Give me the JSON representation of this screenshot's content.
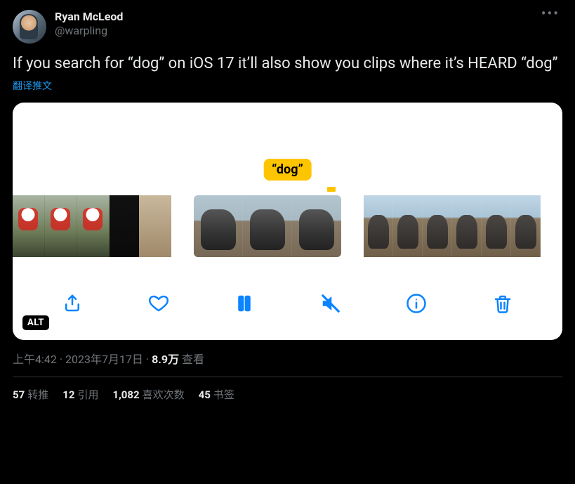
{
  "author": {
    "display_name": "Ryan McLeod",
    "handle": "@warpling"
  },
  "tweet_text": "If you search for “dog” on iOS 17 it’ll also show you clips where it’s HEARD “dog”",
  "translate_label": "翻译推文",
  "media": {
    "search_tag": "“dog”",
    "alt_badge": "ALT"
  },
  "meta": {
    "time": "上午4:42",
    "date": "2023年7月17日",
    "sep": " · ",
    "views_count": "8.9万",
    "views_label": " 查看"
  },
  "stats": {
    "retweets_count": "57",
    "retweets_label": "转推",
    "quotes_count": "12",
    "quotes_label": "引用",
    "likes_count": "1,082",
    "likes_label": "喜欢次数",
    "bookmarks_count": "45",
    "bookmarks_label": "书签"
  }
}
